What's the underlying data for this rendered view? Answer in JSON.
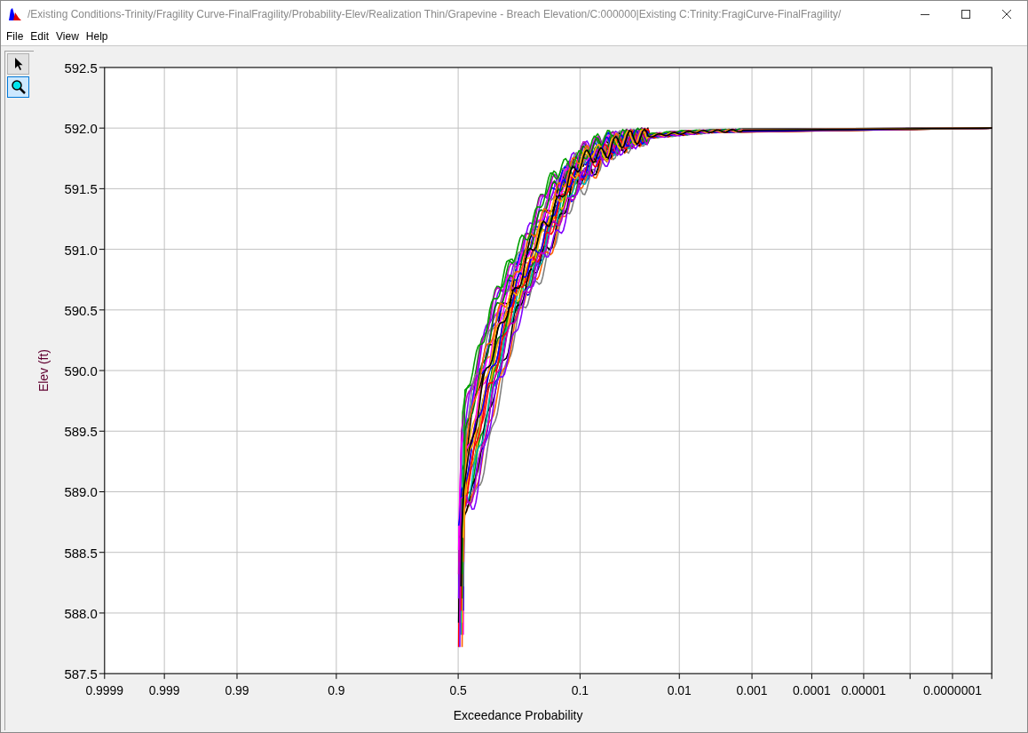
{
  "window": {
    "title": "/Existing Conditions-Trinity/Fragility Curve-FinalFragility/Probability-Elev/Realization Thin/Grapevine - Breach Elevation/C:000000|Existing C:Trinity:FragiCurve-FinalFragility/"
  },
  "menu": [
    "File",
    "Edit",
    "View",
    "Help"
  ],
  "tools": [
    {
      "kind": "pointer",
      "selected": false
    },
    {
      "kind": "zoom",
      "selected": true
    }
  ],
  "chart": {
    "xlabel": "Exceedance Probability",
    "ylabel": "Elev (ft)",
    "yticks": [
      "592.5",
      "592.0",
      "591.5",
      "591.0",
      "590.5",
      "590.0",
      "589.5",
      "589.0",
      "588.5",
      "588.0",
      "587.5"
    ],
    "xticks": [
      "0.9999",
      "0.999",
      "0.99",
      "0.9",
      "0.5",
      "0.1",
      "0.01",
      "0.001",
      "0.0001",
      "0.00001",
      "0.0000001"
    ]
  }
}
